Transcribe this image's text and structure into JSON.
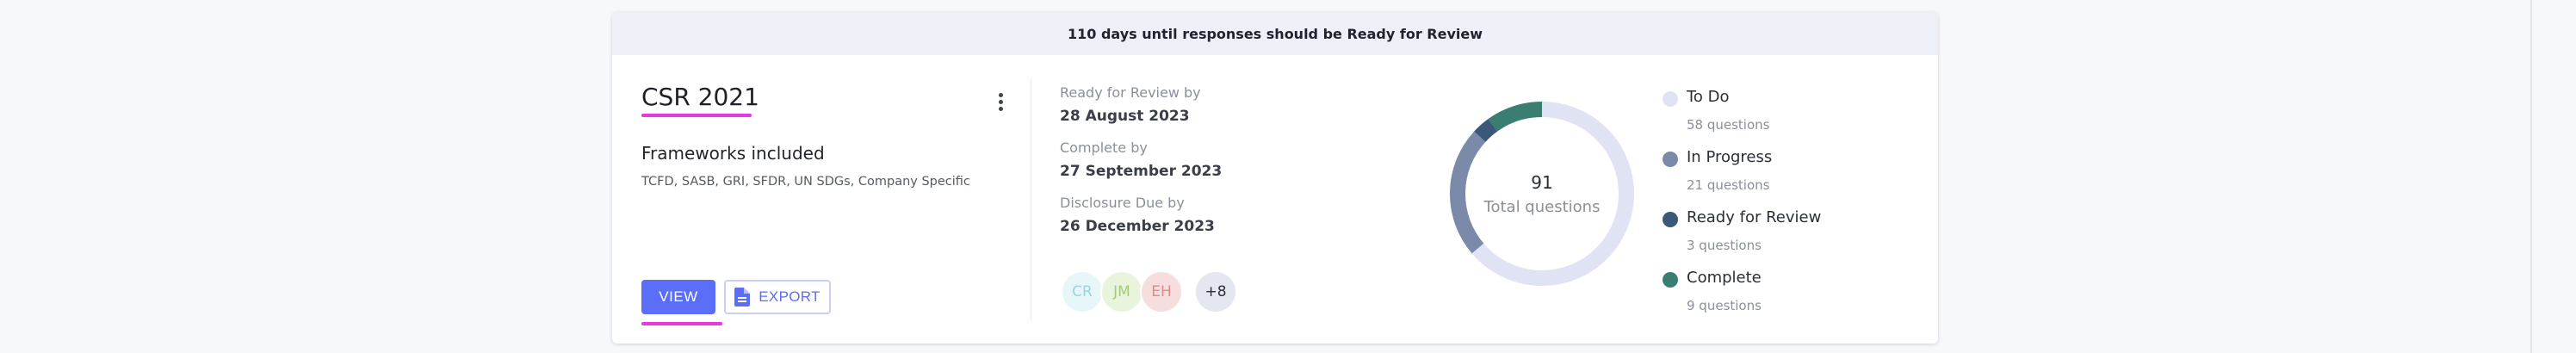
{
  "banner": {
    "text": "110 days until responses should be Ready for Review"
  },
  "report": {
    "title": "CSR 2021",
    "frameworks_heading": "Frameworks included",
    "frameworks_list": "TCFD, SASB, GRI, SFDR, UN SDGs, Company Specific"
  },
  "actions": {
    "view_label": "VIEW",
    "export_label": "EXPORT",
    "export_icon": "document-icon",
    "menu_icon": "kebab-menu-icon"
  },
  "dates": [
    {
      "label": "Ready for Review by",
      "value": "28 August 2023"
    },
    {
      "label": "Complete by",
      "value": "27 September 2023"
    },
    {
      "label": "Disclosure Due by",
      "value": "26 December 2023"
    }
  ],
  "assignees": [
    {
      "initials": "CR",
      "bg": "#e7f6f8",
      "fg": "#9bd5dc"
    },
    {
      "initials": "JM",
      "bg": "#e9f4dc",
      "fg": "#a8c97c"
    },
    {
      "initials": "EH",
      "bg": "#f7dede",
      "fg": "#e08a8a"
    },
    {
      "initials": "+8",
      "bg": "#e4e6f0",
      "fg": "#2a2e39"
    }
  ],
  "summary": {
    "total": "91",
    "caption": "Total questions"
  },
  "status_breakdown": [
    {
      "label": "To Do",
      "count": 58,
      "count_text": "58 questions",
      "color": "#dfe3f4"
    },
    {
      "label": "In Progress",
      "count": 21,
      "count_text": "21 questions",
      "color": "#7b8aa8"
    },
    {
      "label": "Ready for Review",
      "count": 3,
      "count_text": "3 questions",
      "color": "#3c5878"
    },
    {
      "label": "Complete",
      "count": 9,
      "count_text": "9 questions",
      "color": "#3a7e72"
    }
  ]
}
